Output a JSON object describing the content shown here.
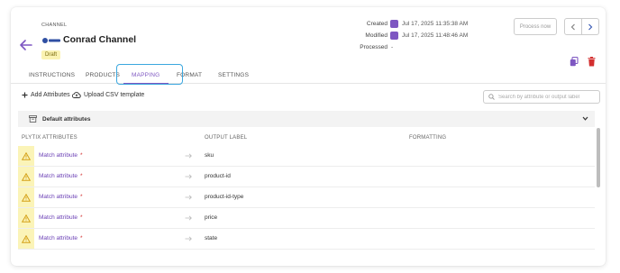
{
  "header": {
    "kicker": "CHANNEL",
    "title": "Conrad Channel",
    "status_badge": "Draft",
    "brand_logo": "conrad-logo",
    "meta": [
      {
        "label": "Created",
        "value": "Jul 17, 2025 11:35:38 AM",
        "icon": "user-avatar-icon"
      },
      {
        "label": "Modified",
        "value": "Jul 17, 2025 11:48:46 AM",
        "icon": "user-avatar-icon"
      },
      {
        "label": "Processed",
        "value": "-",
        "icon": ""
      }
    ],
    "process_button": "Process now"
  },
  "tabs": [
    {
      "label": "INSTRUCTIONS",
      "active": false
    },
    {
      "label": "PRODUCTS",
      "active": false
    },
    {
      "label": "MAPPING",
      "active": true
    },
    {
      "label": "FORMAT",
      "active": false
    },
    {
      "label": "SETTINGS",
      "active": false
    }
  ],
  "toolbar": {
    "add_attributes": "Add Attributes",
    "upload_csv": "Upload CSV template",
    "search_placeholder": "Search by attribute or output label"
  },
  "section": {
    "title": "Default attributes"
  },
  "columns": {
    "attributes": "PLYTIX ATTRIBUTES",
    "output": "OUTPUT LABEL",
    "formatting": "FORMATTING"
  },
  "rows": [
    {
      "attribute": "Match attribute",
      "required": "*",
      "output": "sku"
    },
    {
      "attribute": "Match attribute",
      "required": "*",
      "output": "product-id"
    },
    {
      "attribute": "Match attribute",
      "required": "*",
      "output": "product-id-type"
    },
    {
      "attribute": "Match attribute",
      "required": "*",
      "output": "price"
    },
    {
      "attribute": "Match attribute",
      "required": "*",
      "output": "state"
    }
  ],
  "colors": {
    "accent": "#7e57c2",
    "highlight_ring": "#3aa7df",
    "warning_bg": "#fbf4b8",
    "draft_bg": "#fbf3b3",
    "delete": "#d32f2f"
  }
}
